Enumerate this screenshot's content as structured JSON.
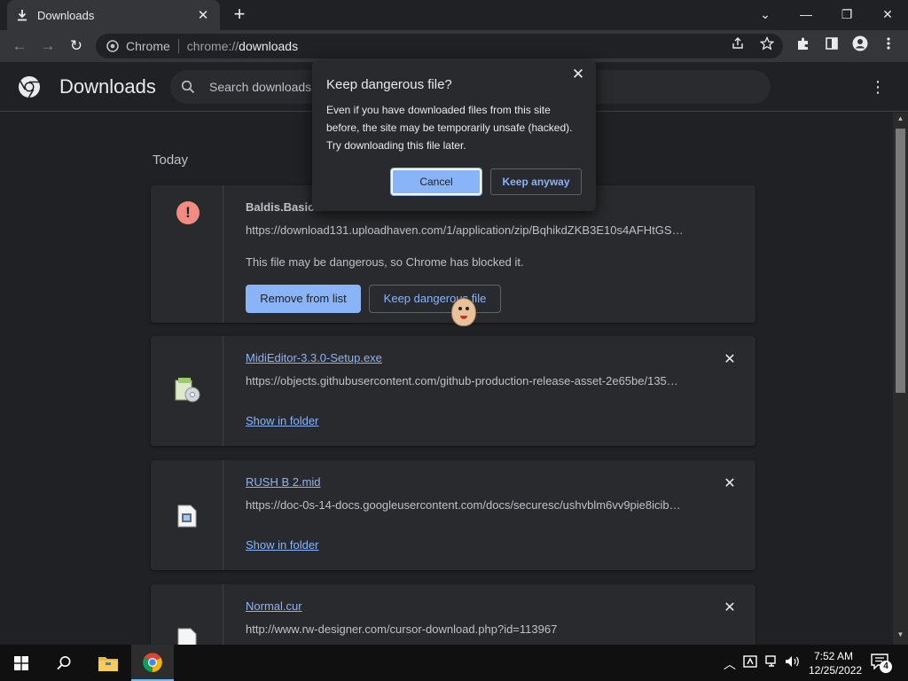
{
  "tab": {
    "title": "Downloads",
    "close_glyph": "✕",
    "new_tab_glyph": "+"
  },
  "window_controls": {
    "tabsearch": "⌄",
    "minimize": "—",
    "restore": "❐",
    "close": "✕"
  },
  "toolbar": {
    "back_glyph": "←",
    "forward_glyph": "→",
    "reload_glyph": "↻",
    "site_name": "Chrome",
    "url_scheme": "chrome://",
    "url_host": "downloads"
  },
  "header": {
    "title": "Downloads",
    "search_placeholder": "Search downloads",
    "menu_glyph": "⋮"
  },
  "section_label": "Today",
  "downloads": [
    {
      "name": "Baldis.Basics",
      "url": "https://download131.uploadhaven.com/1/application/zip/BqhikdZKB3E10s4AFHtGS…",
      "warning": "This file may be dangerous, so Chrome has blocked it.",
      "primary_button": "Remove from list",
      "secondary_button": "Keep dangerous file",
      "icon": "warning-icon"
    },
    {
      "name": "MidiEditor-3.3.0-Setup.exe",
      "url": "https://objects.githubusercontent.com/github-production-release-asset-2e65be/135…",
      "action": "Show in folder",
      "icon": "installer-icon"
    },
    {
      "name": "RUSH B 2.mid",
      "url": "https://doc-0s-14-docs.googleusercontent.com/docs/securesc/ushvblm6vv9pie8icib…",
      "action": "Show in folder",
      "icon": "midi-file-icon"
    },
    {
      "name": "Normal.cur",
      "url": "http://www.rw-designer.com/cursor-download.php?id=113967",
      "icon": "blank-file-icon"
    }
  ],
  "dialog": {
    "title": "Keep dangerous file?",
    "body": "Even if you have downloaded files from this site before, the site may be temporarily unsafe (hacked). Try downloading this file later.",
    "cancel": "Cancel",
    "keep": "Keep anyway",
    "close_glyph": "✕"
  },
  "taskbar": {
    "time": "7:52 AM",
    "date": "12/25/2022",
    "notification_count": "4"
  },
  "colors": {
    "accent": "#8ab4f8",
    "background": "#202124",
    "card": "#292a2d",
    "danger": "#f28b82"
  }
}
